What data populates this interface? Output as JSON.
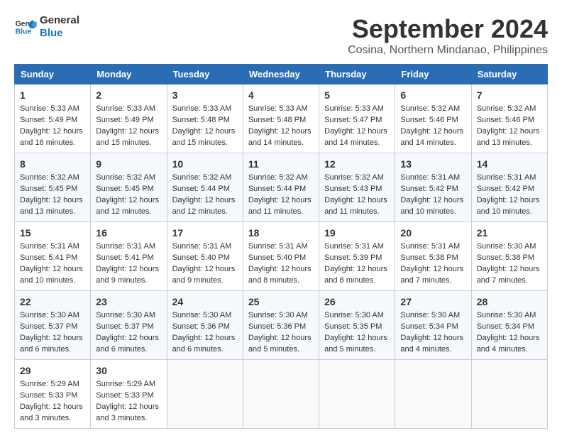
{
  "logo": {
    "line1": "General",
    "line2": "Blue"
  },
  "title": "September 2024",
  "location": "Cosina, Northern Mindanao, Philippines",
  "weekdays": [
    "Sunday",
    "Monday",
    "Tuesday",
    "Wednesday",
    "Thursday",
    "Friday",
    "Saturday"
  ],
  "weeks": [
    [
      {
        "day": "1",
        "lines": [
          "Sunrise: 5:33 AM",
          "Sunset: 5:49 PM",
          "Daylight: 12 hours",
          "and 16 minutes."
        ]
      },
      {
        "day": "2",
        "lines": [
          "Sunrise: 5:33 AM",
          "Sunset: 5:49 PM",
          "Daylight: 12 hours",
          "and 15 minutes."
        ]
      },
      {
        "day": "3",
        "lines": [
          "Sunrise: 5:33 AM",
          "Sunset: 5:48 PM",
          "Daylight: 12 hours",
          "and 15 minutes."
        ]
      },
      {
        "day": "4",
        "lines": [
          "Sunrise: 5:33 AM",
          "Sunset: 5:48 PM",
          "Daylight: 12 hours",
          "and 14 minutes."
        ]
      },
      {
        "day": "5",
        "lines": [
          "Sunrise: 5:33 AM",
          "Sunset: 5:47 PM",
          "Daylight: 12 hours",
          "and 14 minutes."
        ]
      },
      {
        "day": "6",
        "lines": [
          "Sunrise: 5:32 AM",
          "Sunset: 5:46 PM",
          "Daylight: 12 hours",
          "and 14 minutes."
        ]
      },
      {
        "day": "7",
        "lines": [
          "Sunrise: 5:32 AM",
          "Sunset: 5:46 PM",
          "Daylight: 12 hours",
          "and 13 minutes."
        ]
      }
    ],
    [
      {
        "day": "8",
        "lines": [
          "Sunrise: 5:32 AM",
          "Sunset: 5:45 PM",
          "Daylight: 12 hours",
          "and 13 minutes."
        ]
      },
      {
        "day": "9",
        "lines": [
          "Sunrise: 5:32 AM",
          "Sunset: 5:45 PM",
          "Daylight: 12 hours",
          "and 12 minutes."
        ]
      },
      {
        "day": "10",
        "lines": [
          "Sunrise: 5:32 AM",
          "Sunset: 5:44 PM",
          "Daylight: 12 hours",
          "and 12 minutes."
        ]
      },
      {
        "day": "11",
        "lines": [
          "Sunrise: 5:32 AM",
          "Sunset: 5:44 PM",
          "Daylight: 12 hours",
          "and 11 minutes."
        ]
      },
      {
        "day": "12",
        "lines": [
          "Sunrise: 5:32 AM",
          "Sunset: 5:43 PM",
          "Daylight: 12 hours",
          "and 11 minutes."
        ]
      },
      {
        "day": "13",
        "lines": [
          "Sunrise: 5:31 AM",
          "Sunset: 5:42 PM",
          "Daylight: 12 hours",
          "and 10 minutes."
        ]
      },
      {
        "day": "14",
        "lines": [
          "Sunrise: 5:31 AM",
          "Sunset: 5:42 PM",
          "Daylight: 12 hours",
          "and 10 minutes."
        ]
      }
    ],
    [
      {
        "day": "15",
        "lines": [
          "Sunrise: 5:31 AM",
          "Sunset: 5:41 PM",
          "Daylight: 12 hours",
          "and 10 minutes."
        ]
      },
      {
        "day": "16",
        "lines": [
          "Sunrise: 5:31 AM",
          "Sunset: 5:41 PM",
          "Daylight: 12 hours",
          "and 9 minutes."
        ]
      },
      {
        "day": "17",
        "lines": [
          "Sunrise: 5:31 AM",
          "Sunset: 5:40 PM",
          "Daylight: 12 hours",
          "and 9 minutes."
        ]
      },
      {
        "day": "18",
        "lines": [
          "Sunrise: 5:31 AM",
          "Sunset: 5:40 PM",
          "Daylight: 12 hours",
          "and 8 minutes."
        ]
      },
      {
        "day": "19",
        "lines": [
          "Sunrise: 5:31 AM",
          "Sunset: 5:39 PM",
          "Daylight: 12 hours",
          "and 8 minutes."
        ]
      },
      {
        "day": "20",
        "lines": [
          "Sunrise: 5:31 AM",
          "Sunset: 5:38 PM",
          "Daylight: 12 hours",
          "and 7 minutes."
        ]
      },
      {
        "day": "21",
        "lines": [
          "Sunrise: 5:30 AM",
          "Sunset: 5:38 PM",
          "Daylight: 12 hours",
          "and 7 minutes."
        ]
      }
    ],
    [
      {
        "day": "22",
        "lines": [
          "Sunrise: 5:30 AM",
          "Sunset: 5:37 PM",
          "Daylight: 12 hours",
          "and 6 minutes."
        ]
      },
      {
        "day": "23",
        "lines": [
          "Sunrise: 5:30 AM",
          "Sunset: 5:37 PM",
          "Daylight: 12 hours",
          "and 6 minutes."
        ]
      },
      {
        "day": "24",
        "lines": [
          "Sunrise: 5:30 AM",
          "Sunset: 5:36 PM",
          "Daylight: 12 hours",
          "and 6 minutes."
        ]
      },
      {
        "day": "25",
        "lines": [
          "Sunrise: 5:30 AM",
          "Sunset: 5:36 PM",
          "Daylight: 12 hours",
          "and 5 minutes."
        ]
      },
      {
        "day": "26",
        "lines": [
          "Sunrise: 5:30 AM",
          "Sunset: 5:35 PM",
          "Daylight: 12 hours",
          "and 5 minutes."
        ]
      },
      {
        "day": "27",
        "lines": [
          "Sunrise: 5:30 AM",
          "Sunset: 5:34 PM",
          "Daylight: 12 hours",
          "and 4 minutes."
        ]
      },
      {
        "day": "28",
        "lines": [
          "Sunrise: 5:30 AM",
          "Sunset: 5:34 PM",
          "Daylight: 12 hours",
          "and 4 minutes."
        ]
      }
    ],
    [
      {
        "day": "29",
        "lines": [
          "Sunrise: 5:29 AM",
          "Sunset: 5:33 PM",
          "Daylight: 12 hours",
          "and 3 minutes."
        ]
      },
      {
        "day": "30",
        "lines": [
          "Sunrise: 5:29 AM",
          "Sunset: 5:33 PM",
          "Daylight: 12 hours",
          "and 3 minutes."
        ]
      },
      {
        "day": "",
        "lines": []
      },
      {
        "day": "",
        "lines": []
      },
      {
        "day": "",
        "lines": []
      },
      {
        "day": "",
        "lines": []
      },
      {
        "day": "",
        "lines": []
      }
    ]
  ]
}
